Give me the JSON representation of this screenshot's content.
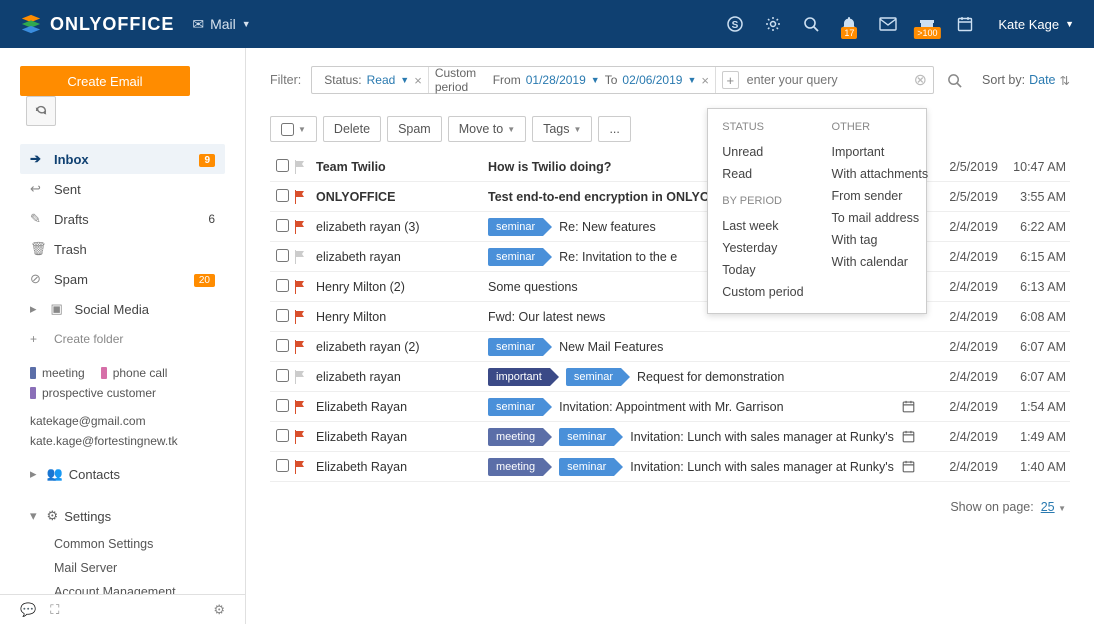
{
  "brand": "ONLYOFFICE",
  "app": {
    "name": "Mail"
  },
  "user": {
    "name": "Kate Kage"
  },
  "topbar_badges": {
    "bell": "17",
    "present": ">100"
  },
  "sidebar": {
    "create_label": "Create Email",
    "folders": {
      "inbox": {
        "label": "Inbox",
        "badge": "9"
      },
      "sent": {
        "label": "Sent"
      },
      "drafts": {
        "label": "Drafts",
        "count": "6"
      },
      "trash": {
        "label": "Trash"
      },
      "spam": {
        "label": "Spam",
        "badge": "20"
      },
      "social": {
        "label": "Social Media"
      },
      "create_folder": "Create folder"
    },
    "tags": [
      {
        "label": "meeting",
        "color": "#5b6ea8"
      },
      {
        "label": "phone call",
        "color": "#d66fa8"
      },
      {
        "label": "prospective customer",
        "color": "#8a6fb8"
      }
    ],
    "accounts": [
      "katekage@gmail.com",
      "kate.kage@fortestingnew.tk"
    ],
    "contacts_label": "Contacts",
    "settings_label": "Settings",
    "settings_children": [
      "Common Settings",
      "Mail Server",
      "Account Management"
    ]
  },
  "filter": {
    "label": "Filter:",
    "status_label": "Status:",
    "status_value": "Read",
    "period_label": "Custom period",
    "period_from_label": "From",
    "period_from": "01/28/2019",
    "period_to_label": "To",
    "period_to": "02/06/2019",
    "input_placeholder": "enter your query",
    "sort_label": "Sort by:",
    "sort_value": "Date"
  },
  "toolbar": {
    "delete": "Delete",
    "spam": "Spam",
    "move": "Move to",
    "tags": "Tags",
    "more": "..."
  },
  "dropdown": {
    "status_head": "STATUS",
    "status_opts": [
      "Unread",
      "Read"
    ],
    "period_head": "BY PERIOD",
    "period_opts": [
      "Last week",
      "Yesterday",
      "Today",
      "Custom period"
    ],
    "other_head": "OTHER",
    "other_opts": [
      "Important",
      "With attachments",
      "From sender",
      "To mail address",
      "With tag",
      "With calendar"
    ]
  },
  "emails": [
    {
      "from": "Team Twilio",
      "subject": "How is Twilio doing?",
      "tags": [],
      "flag": false,
      "unread": true,
      "att": false,
      "cal": false,
      "date": "2/5/2019",
      "time": "10:47 AM"
    },
    {
      "from": "ONLYOFFICE",
      "subject": "Test end-to-end encryption in ONLYO",
      "tags": [],
      "flag": true,
      "unread": true,
      "att": false,
      "cal": false,
      "date": "2/5/2019",
      "time": "3:55 AM"
    },
    {
      "from": "elizabeth rayan (3)",
      "subject": "Re: New features",
      "tags": [
        "seminar"
      ],
      "flag": true,
      "unread": false,
      "att": true,
      "cal": false,
      "date": "2/4/2019",
      "time": "6:22 AM"
    },
    {
      "from": "elizabeth rayan",
      "subject": "Re: Invitation to the e",
      "tags": [
        "seminar"
      ],
      "flag": false,
      "unread": false,
      "att": false,
      "cal": false,
      "date": "2/4/2019",
      "time": "6:15 AM"
    },
    {
      "from": "Henry Milton (2)",
      "subject": "Some questions",
      "tags": [],
      "flag": true,
      "unread": false,
      "att": false,
      "cal": false,
      "date": "2/4/2019",
      "time": "6:13 AM"
    },
    {
      "from": "Henry Milton",
      "subject": "Fwd: Our latest news",
      "tags": [],
      "flag": true,
      "unread": false,
      "att": false,
      "cal": false,
      "date": "2/4/2019",
      "time": "6:08 AM"
    },
    {
      "from": "elizabeth rayan (2)",
      "subject": "New Mail Features",
      "tags": [
        "seminar"
      ],
      "flag": true,
      "unread": false,
      "att": false,
      "cal": false,
      "date": "2/4/2019",
      "time": "6:07 AM"
    },
    {
      "from": "elizabeth rayan",
      "subject": "Request for demonstration",
      "tags": [
        "important",
        "seminar"
      ],
      "flag": false,
      "unread": false,
      "att": false,
      "cal": false,
      "date": "2/4/2019",
      "time": "6:07 AM"
    },
    {
      "from": "Elizabeth Rayan",
      "subject": "Invitation: Appointment with Mr. Garrison",
      "tags": [
        "seminar"
      ],
      "flag": true,
      "unread": false,
      "att": false,
      "cal": true,
      "date": "2/4/2019",
      "time": "1:54 AM"
    },
    {
      "from": "Elizabeth Rayan",
      "subject": "Invitation: Lunch with sales manager at Runky's",
      "tags": [
        "meeting",
        "seminar"
      ],
      "flag": true,
      "unread": false,
      "att": false,
      "cal": true,
      "date": "2/4/2019",
      "time": "1:49 AM"
    },
    {
      "from": "Elizabeth Rayan",
      "subject": "Invitation: Lunch with sales manager at Runky's",
      "tags": [
        "meeting",
        "seminar"
      ],
      "flag": true,
      "unread": false,
      "att": false,
      "cal": true,
      "date": "2/4/2019",
      "time": "1:40 AM"
    }
  ],
  "pager": {
    "label": "Show on page:",
    "value": "25"
  }
}
